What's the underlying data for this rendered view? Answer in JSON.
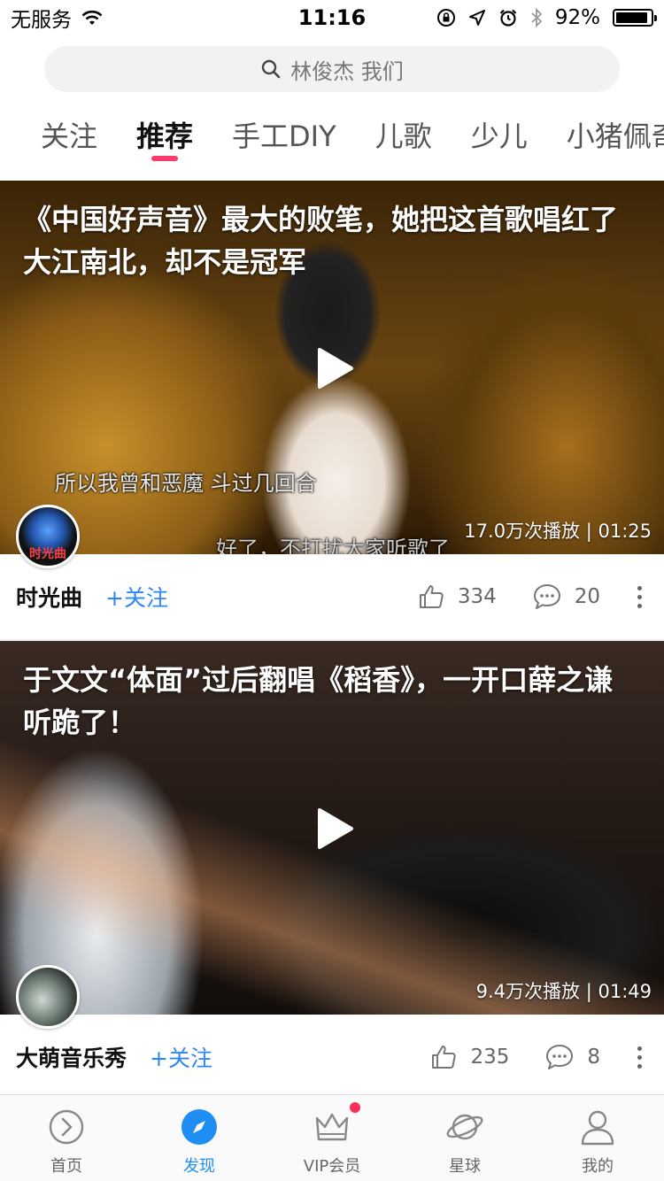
{
  "status_bar": {
    "carrier": "无服务",
    "time": "11:16",
    "battery_text": "92%",
    "battery_level": 0.92
  },
  "search": {
    "placeholder": "林俊杰 我们"
  },
  "tabs": [
    {
      "label": "关注",
      "active": false
    },
    {
      "label": "推荐",
      "active": true
    },
    {
      "label": "手工DIY",
      "active": false
    },
    {
      "label": "儿歌",
      "active": false
    },
    {
      "label": "少儿",
      "active": false
    },
    {
      "label": "小猪佩奇",
      "active": false
    }
  ],
  "feed": [
    {
      "title": "《中国好声音》最大的败笔，她把这首歌唱红了大江南北，却不是冠军",
      "subtitle_1": "所以我曾和恶魔 斗过几回合",
      "subtitle_2": "好了，不打扰大家听歌了",
      "meta": "17.0万次播放 | 01:25",
      "avatar_text": "时光曲",
      "author": "时光曲",
      "follow_label": "+关注",
      "likes": "334",
      "comments": "20"
    },
    {
      "title": "于文文“体面”过后翻唱《稻香》，一开口薛之谦听跪了！",
      "meta": "9.4万次播放 | 01:49",
      "author": "大萌音乐秀",
      "follow_label": "+关注",
      "likes": "235",
      "comments": "8"
    }
  ],
  "bottom_nav": [
    {
      "label": "首页",
      "icon": "play-circle-icon",
      "active": false
    },
    {
      "label": "发现",
      "icon": "compass-icon",
      "active": true
    },
    {
      "label": "VIP会员",
      "icon": "crown-icon",
      "active": false,
      "badge": true
    },
    {
      "label": "星球",
      "icon": "planet-icon",
      "active": false
    },
    {
      "label": "我的",
      "icon": "person-icon",
      "active": false
    }
  ],
  "colors": {
    "accent_blue": "#1e8ef3",
    "follow_blue": "#2f86f6",
    "tab_indicator": "#ff3b6b",
    "badge": "#ff2d55"
  }
}
